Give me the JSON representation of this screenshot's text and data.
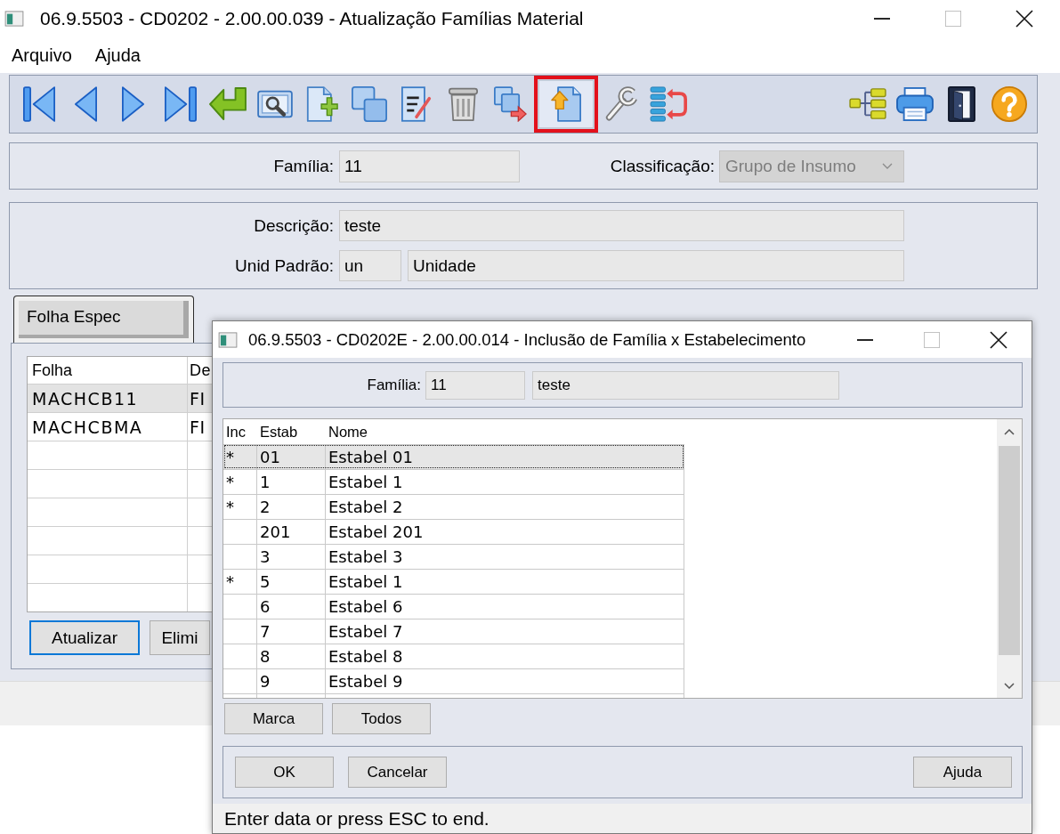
{
  "window": {
    "title": "06.9.5503 - CD0202 - 2.00.00.039 - Atualização Famílias Material"
  },
  "menu": [
    {
      "label": "Arquivo"
    },
    {
      "label": "Ajuda"
    }
  ],
  "toolbar": {
    "left_buttons": [
      {
        "highlighted": false
      },
      {
        "highlighted": false
      },
      {
        "highlighted": false
      },
      {
        "highlighted": false
      },
      {
        "highlighted": false
      },
      {
        "highlighted": false
      },
      {
        "highlighted": false
      },
      {
        "highlighted": false
      },
      {
        "highlighted": false
      },
      {
        "highlighted": false
      },
      {
        "highlighted": false
      },
      {
        "highlighted": true
      },
      {
        "highlighted": false
      },
      {
        "highlighted": false
      }
    ],
    "right_buttons": [
      {
        "highlighted": false
      },
      {
        "highlighted": false
      },
      {
        "highlighted": false
      },
      {
        "highlighted": false
      }
    ]
  },
  "header_panel": {
    "familia": {
      "label": "Família:",
      "value": "11"
    },
    "classificacao": {
      "label": "Classificação:",
      "value": "Grupo de Insumo",
      "disabled": true
    }
  },
  "detail_panel": {
    "descricao": {
      "label": "Descrição:",
      "value": "teste"
    },
    "unid_padrao": {
      "label": "Unid Padrão:",
      "code": "un",
      "name": "Unidade"
    }
  },
  "tabs": [
    {
      "label": "Folha Espec",
      "selected": true
    }
  ],
  "sheet_table": {
    "columns": [
      "Folha",
      "De"
    ],
    "rows": [
      {
        "cells": [
          "MACHCB11",
          "FI"
        ],
        "selected": true
      },
      {
        "cells": [
          "MACHCBMA",
          "FI"
        ],
        "selected": false
      }
    ]
  },
  "tab_buttons": [
    {
      "label": "Atualizar",
      "focused": true
    },
    {
      "label": "Elimi",
      "focused": false
    }
  ],
  "dialog": {
    "title": "06.9.5503 - CD0202E - 2.00.00.014 - Inclusão de Família x Estabelecimento",
    "familia": {
      "label": "Família:",
      "code": "11",
      "description": "teste"
    },
    "table": {
      "columns": [
        "Inc",
        "Estab",
        "Nome"
      ],
      "rows": [
        {
          "inc": "*",
          "estab": "01",
          "nome": "Estabel 01",
          "selected": true
        },
        {
          "inc": "*",
          "estab": "1",
          "nome": "Estabel 1",
          "selected": false
        },
        {
          "inc": "*",
          "estab": "2",
          "nome": "Estabel 2",
          "selected": false
        },
        {
          "estab": "201",
          "nome": "Estabel 201",
          "selected": false
        },
        {
          "estab": "3",
          "nome": "Estabel 3",
          "selected": false
        },
        {
          "inc": "*",
          "estab": "5",
          "nome": "Estabel 1",
          "selected": false
        },
        {
          "estab": "6",
          "nome": "Estabel 6",
          "selected": false
        },
        {
          "estab": "7",
          "nome": "Estabel 7",
          "selected": false
        },
        {
          "estab": "8",
          "nome": "Estabel 8",
          "selected": false
        },
        {
          "estab": "9",
          "nome": "Estabel 9",
          "selected": false
        }
      ]
    },
    "list_buttons": [
      {
        "label": "Marca"
      },
      {
        "label": "Todos"
      }
    ],
    "footer_left_buttons": [
      {
        "label": "OK"
      },
      {
        "label": "Cancelar"
      }
    ],
    "footer_right_buttons": [
      {
        "label": "Ajuda"
      }
    ],
    "status_bar": {
      "text": "Enter data or press ESC to end."
    }
  }
}
